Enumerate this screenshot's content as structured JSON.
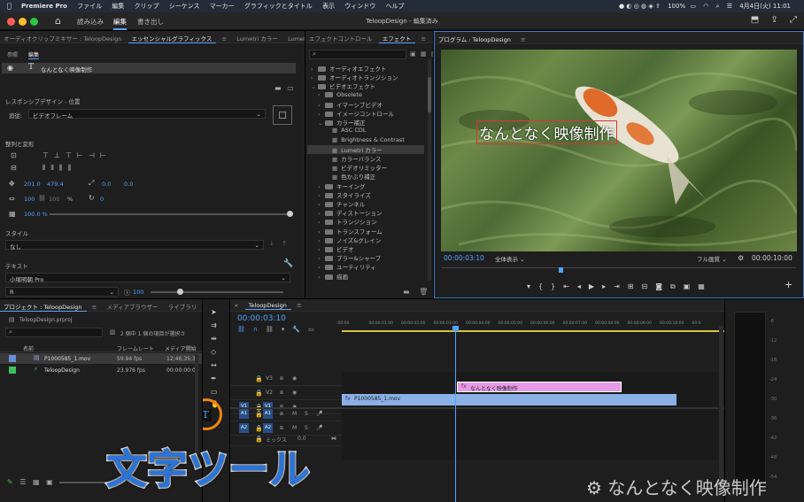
{
  "menubar": {
    "app": "Premiere Pro",
    "items": [
      "ファイル",
      "編集",
      "クリップ",
      "シーケンス",
      "マーカー",
      "グラフィックとタイトル",
      "表示",
      "ウィンドウ",
      "ヘルプ"
    ],
    "battery": "100%",
    "clock": "4月4日(火) 11:01"
  },
  "titlebar": {
    "tabs": [
      "読み込み",
      "編集",
      "書き出し"
    ],
    "active_tab": "編集",
    "doc_title": "TeloopDesign - 編集済み"
  },
  "eg_panel": {
    "tabs": [
      "オーディオクリップミキサー : TeloopDesign",
      "エッセンシャルグラフィックス",
      "Lumetri カラー",
      "Lumetri"
    ],
    "subtabs": [
      "参照",
      "編集"
    ],
    "layer_name": "なんとなく映像制作",
    "responsive_label": "レスポンシブデザイン - 位置",
    "follow_label": "追従:",
    "follow_value": "ビデオフレーム",
    "align_label": "整列と変形",
    "pos_x": "201.0",
    "pos_y": "479.4",
    "anchor_x": "0.0",
    "anchor_y": "0.0",
    "scale_w": "100",
    "scale_h": "100",
    "scale_unit": "%",
    "rotation": "0",
    "opacity": "100.0 %",
    "style_label": "スタイル",
    "style_value": "なし",
    "text_label": "テキスト",
    "font_value": "小塚明朝 Pro",
    "font_style": "R",
    "font_size": "100"
  },
  "effects_panel": {
    "tabs": [
      "エフェクトコントロール",
      "エフェクト"
    ],
    "items": [
      {
        "label": "オーディオエフェクト",
        "level": 1,
        "type": "folder"
      },
      {
        "label": "オーディオトランジション",
        "level": 1,
        "type": "folder"
      },
      {
        "label": "ビデオエフェクト",
        "level": 1,
        "type": "folder",
        "open": true
      },
      {
        "label": "Obsolete",
        "level": 2,
        "type": "folder"
      },
      {
        "label": "イマーシブビデオ",
        "level": 2,
        "type": "folder"
      },
      {
        "label": "イメージコントロール",
        "level": 2,
        "type": "folder"
      },
      {
        "label": "カラー補正",
        "level": 2,
        "type": "folder",
        "open": true
      },
      {
        "label": "ASC CDL",
        "level": 3,
        "type": "fx"
      },
      {
        "label": "Brightness & Contrast",
        "level": 3,
        "type": "fx"
      },
      {
        "label": "Lumetri カラー",
        "level": 3,
        "type": "fx",
        "selected": true
      },
      {
        "label": "カラーバランス",
        "level": 3,
        "type": "fx"
      },
      {
        "label": "ビデオリミッター",
        "level": 3,
        "type": "fx"
      },
      {
        "label": "色かぶり補正",
        "level": 3,
        "type": "fx"
      },
      {
        "label": "キーイング",
        "level": 2,
        "type": "folder"
      },
      {
        "label": "スタイライズ",
        "level": 2,
        "type": "folder"
      },
      {
        "label": "チャンネル",
        "level": 2,
        "type": "folder"
      },
      {
        "label": "ディストーション",
        "level": 2,
        "type": "folder"
      },
      {
        "label": "トランジション",
        "level": 2,
        "type": "folder"
      },
      {
        "label": "トランスフォーム",
        "level": 2,
        "type": "folder"
      },
      {
        "label": "ノイズ&グレイン",
        "level": 2,
        "type": "folder"
      },
      {
        "label": "ビデオ",
        "level": 2,
        "type": "folder"
      },
      {
        "label": "ブラー&シャープ",
        "level": 2,
        "type": "folder"
      },
      {
        "label": "ユーティリティ",
        "level": 2,
        "type": "folder"
      },
      {
        "label": "描画",
        "level": 2,
        "type": "folder"
      }
    ]
  },
  "program_monitor": {
    "title": "プログラム : TeloopDesign",
    "overlay_text": "なんとなく映像制作",
    "timecode": "00:00:03:10",
    "fit": "全体表示",
    "quality": "フル画質",
    "duration": "00:00:10:00"
  },
  "project_panel": {
    "tabs": [
      "プロジェクト : TeloopDesign",
      "メディアブラウザー",
      "ライブラリ"
    ],
    "file": "TeloopDesign.prproj",
    "selection_info": "2 個中 1 個の項目が選択さ",
    "columns": [
      "名前",
      "フレームレート",
      "メディア開始"
    ],
    "rows": [
      {
        "name": "P1000585_1.mov",
        "fps": "59.94 fps",
        "start": "12;46;35;38",
        "color": "#6a8fd8"
      },
      {
        "name": "TeloopDesign",
        "fps": "23.976 fps",
        "start": "00:00:00:00",
        "color": "#3fbf5a"
      }
    ]
  },
  "timeline": {
    "tab": "TeloopDesign",
    "timecode": "00:00:03:10",
    "ruler": [
      ":00:00",
      "00:00:01:00",
      "00:00:02:00",
      "00:00:03:00",
      "00:00:04:00",
      "00:00:05:00",
      "00:00:06:00",
      "00:00:07:00",
      "00:00:08:00",
      "00:00:09:00",
      "00:00:10:00",
      "00:0"
    ],
    "tracks": [
      "V3",
      "V2",
      "V1",
      "A1",
      "A2"
    ],
    "mix_label": "ミックス",
    "mix_value": "0.0",
    "title_clip": "なんとなく映像制作",
    "video_clip": "P1000585_1.mov",
    "meter_labels": [
      "-6",
      "-12",
      "-18",
      "-24",
      "-30",
      "-36",
      "-42",
      "-48",
      "-54"
    ]
  },
  "caption": "文字ツール",
  "watermark": "なんとなく映像制作",
  "colors": {
    "accent": "#4ea3ff",
    "title_clip": "#e79ae8",
    "video_clip": "#8ab0e6",
    "highlight": "#f0860f"
  }
}
